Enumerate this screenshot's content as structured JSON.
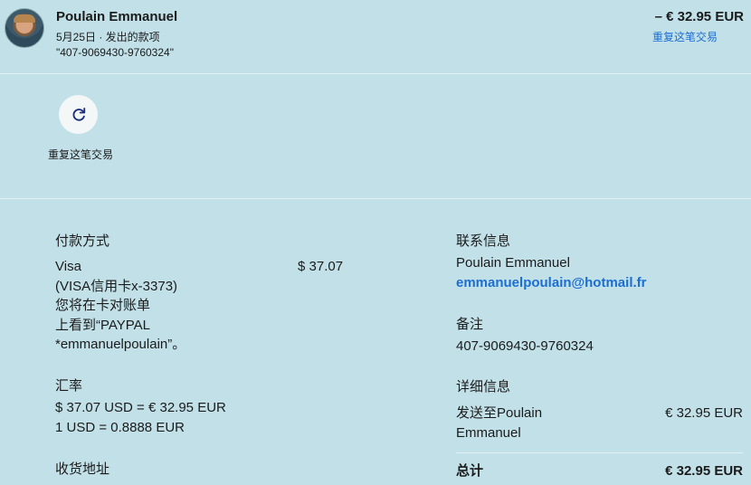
{
  "header": {
    "name": "Poulain Emmanuel",
    "meta": "5月25日 · 发出的款项",
    "reference": "\"407-9069430-9760324\"",
    "amount": "– € 32.95 EUR",
    "repeat_link": "重复这笔交易"
  },
  "actions": {
    "repeat_label": "重复这笔交易",
    "icon": "refresh-icon"
  },
  "payment": {
    "title": "付款方式",
    "method": "Visa",
    "card": "(VISA信用卡x-3373)",
    "statement_line1": "您将在卡对账单",
    "statement_line2": "上看到“PAYPAL",
    "statement_line3": "*emmanuelpoulain”。",
    "amount": "$ 37.07"
  },
  "exchange": {
    "title": "汇率",
    "line1": "$ 37.07 USD = € 32.95 EUR",
    "line2": "1 USD = 0.8888 EUR"
  },
  "shipping": {
    "title": "收货地址"
  },
  "contact": {
    "title": "联系信息",
    "name": "Poulain Emmanuel",
    "email": "emmanuelpoulain@hotmail.fr"
  },
  "note": {
    "title": "备注",
    "value": "407-9069430-9760324"
  },
  "details": {
    "title": "详细信息",
    "sent_to_line1": "发送至Poulain",
    "sent_to_line2": "Emmanuel",
    "sent_amount": "€ 32.95 EUR",
    "total_label": "总计",
    "total_amount": "€ 32.95 EUR"
  },
  "colors": {
    "background": "#c2e0e8",
    "link": "#1c6ed1"
  }
}
